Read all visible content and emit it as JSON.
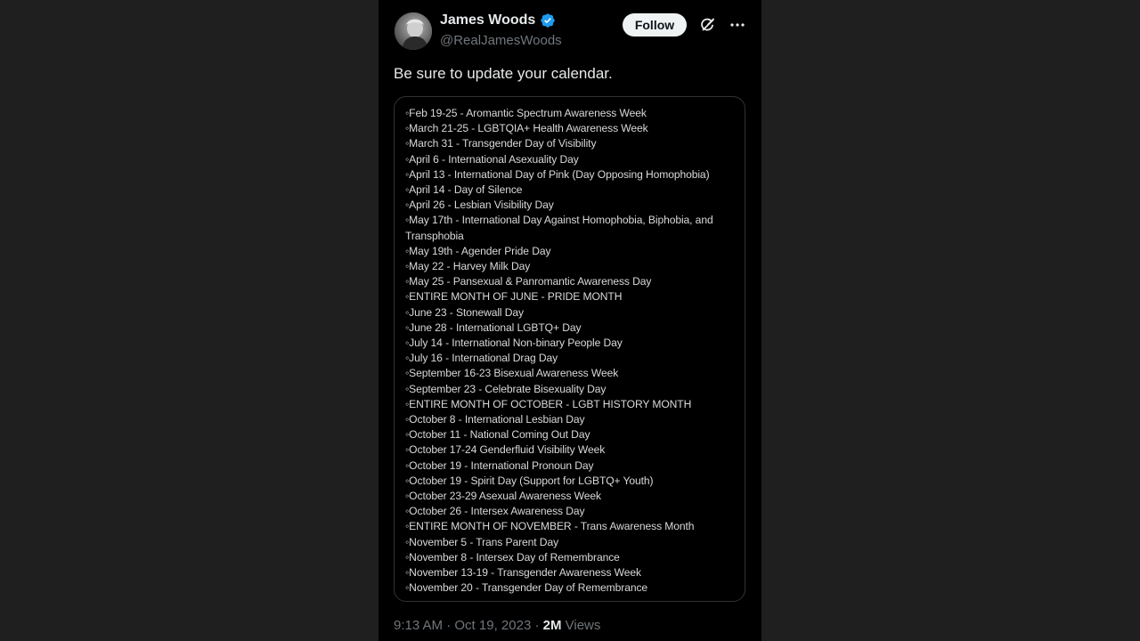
{
  "author": {
    "display_name": "James Woods",
    "handle": "@RealJamesWoods",
    "verified": true
  },
  "actions": {
    "follow_label": "Follow"
  },
  "post": {
    "text": "Be sure to update your calendar.",
    "media_lines": [
      "◦Feb 19-25 - Aromantic Spectrum Awareness Week",
      "◦March 21-25 - LGBTQIA+ Health Awareness Week",
      "◦March 31 - Transgender Day of Visibility",
      "◦April 6 - International Asexuality Day",
      "◦April 13 - International Day of Pink (Day Opposing Homophobia)",
      "◦April 14 - Day of Silence",
      "◦April 26 - Lesbian Visibility Day",
      "◦May 17th - International Day Against Homophobia, Biphobia, and Transphobia",
      "◦May 19th - Agender Pride Day",
      "◦May 22 - Harvey Milk Day",
      "◦May 25 - Pansexual & Panromantic Awareness Day",
      "◦ENTIRE MONTH OF JUNE - PRIDE MONTH",
      "◦June 23 - Stonewall Day",
      "◦June 28 - International LGBTQ+ Day",
      "◦July 14 - International Non-binary People Day",
      "◦July 16 - International Drag Day",
      "◦September 16-23 Bisexual Awareness Week",
      "◦September 23 - Celebrate Bisexuality Day",
      "◦ENTIRE MONTH OF OCTOBER - LGBT HISTORY MONTH",
      "◦October 8 - International Lesbian Day",
      "◦October 11 - National Coming Out Day",
      "◦October 17-24 Genderfluid Visibility Week",
      "◦October 19 - International Pronoun Day",
      "◦October 19 - Spirit Day (Support for LGBTQ+ Youth)",
      "◦October 23-29 Asexual Awareness Week",
      "◦October 26 - Intersex Awareness Day",
      "◦ENTIRE MONTH OF NOVEMBER - Trans Awareness Month",
      "◦November 5 - Trans Parent Day",
      "◦November 8 - Intersex Day of Remembrance",
      "◦November 13-19 - Transgender Awareness Week",
      "◦November 20 - Transgender Day of Remembrance"
    ]
  },
  "meta": {
    "time": "9:13 AM",
    "separator": " · ",
    "date": "Oct 19, 2023",
    "views_count": "2M",
    "views_label": " Views"
  },
  "icons": {
    "verified": "verified-badge-icon",
    "grok": "grok-icon",
    "more": "more-horizontal-icon"
  },
  "colors": {
    "background": "#000000",
    "outer_background": "#1f1f1f",
    "primary_text": "#e7e9ea",
    "secondary_text": "#71767b",
    "verified_blue": "#1d9bf0",
    "border": "#2f3336"
  }
}
